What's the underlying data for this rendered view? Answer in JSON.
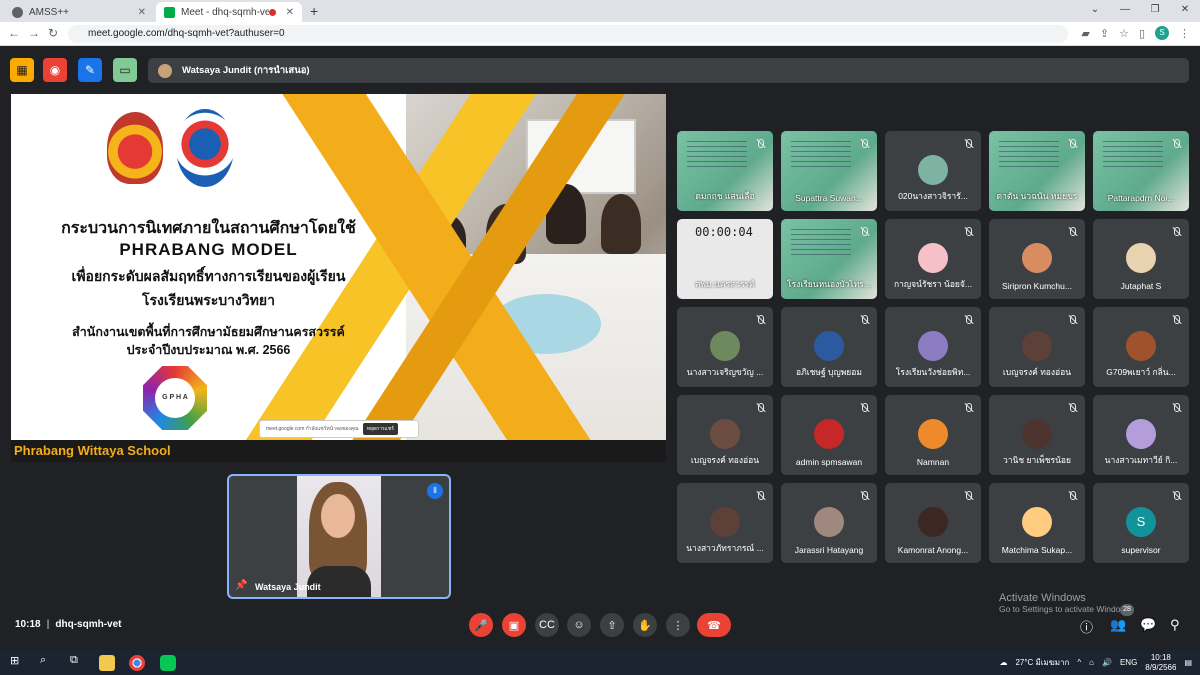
{
  "browser": {
    "tabs": [
      {
        "title": "AMSS++",
        "active": false
      },
      {
        "title": "Meet - dhq-sqmh-vet",
        "active": true
      }
    ],
    "url": "meet.google.com/dhq-sqmh-vet?authuser=0",
    "profile_initial": "S"
  },
  "meet": {
    "presenter_label": "Watsaya Jundit (การนำเสนอ)",
    "slide": {
      "line1": "กระบวนการนิเทศภายในสถานศึกษาโดยใช้",
      "line2": "PHRABANG MODEL",
      "line3": "เพื่อยกระดับผลสัมฤทธิ์ทางการเรียนของผู้เรียน",
      "line4": "โรงเรียนพระบางวิทยา",
      "line5": "สำนักงานเขตพื้นที่การศึกษามัธยมศึกษานครสวรรค์",
      "line6": "ประจำปีงบประมาณ พ.ศ. 2566",
      "logo_text": "G P H A",
      "share_text": "meet.google.com กำลังแชร์หน้าจอของคุณ",
      "share_button": "หยุดการแชร์",
      "school_name": "Phrabang Wittaya School"
    },
    "self_tile": {
      "name": "Watsaya Jundit"
    },
    "participants": [
      {
        "name": "ดมกฤช แสนเลื่อ",
        "kind": "video"
      },
      {
        "name": "Supattra Suwan...",
        "kind": "video"
      },
      {
        "name": "020นางสาวจิรารั...",
        "kind": "avatar",
        "color": "#7fb3a1"
      },
      {
        "name": "ดาตัน นวฉนัน หมยขร",
        "kind": "video"
      },
      {
        "name": "Pattarapdrn Noi...",
        "kind": "video"
      },
      {
        "name": "สพม.นครสวรรค์",
        "kind": "clock",
        "clock": "00:00:04"
      },
      {
        "name": "โรงเรียนหนองบัวไทร...",
        "kind": "video"
      },
      {
        "name": "กาญจน์รัชรา น้อยจั...",
        "kind": "avatar",
        "color": "#f6c0c8"
      },
      {
        "name": "Siripron Kumchu...",
        "kind": "avatar",
        "color": "#d98c5f"
      },
      {
        "name": "Jutaphat S",
        "kind": "avatar",
        "color": "#e8d2b0"
      },
      {
        "name": "นางสาวเจริญขวัญ ...",
        "kind": "avatar",
        "color": "#6d8a5e"
      },
      {
        "name": "อภิเชษฐ์ บุญพยอม",
        "kind": "avatar",
        "color": "#2c5aa0"
      },
      {
        "name": "โรงเรียนวังช่อยพิท...",
        "kind": "avatar",
        "color": "#8e7cc3"
      },
      {
        "name": "เบญจรงค์ ทองอ่อน",
        "kind": "avatar",
        "color": "#5d4037"
      },
      {
        "name": "G709พเยาว์ กลิ่น...",
        "kind": "avatar",
        "color": "#a0522d"
      },
      {
        "name": "เบญจรงค์ ทองอ่อน",
        "kind": "avatar",
        "color": "#6d4c41"
      },
      {
        "name": "admin spmsawan",
        "kind": "avatar",
        "color": "#c62828"
      },
      {
        "name": "Namnan",
        "kind": "avatar",
        "color": "#ef8a2b"
      },
      {
        "name": "วานิช ยาเพ็ชรน้อย",
        "kind": "avatar",
        "color": "#4e342e"
      },
      {
        "name": "นางสาวเมทาวีย์ กิ...",
        "kind": "avatar",
        "color": "#b39ddb"
      },
      {
        "name": "นางสาวภัทราภรณ์ ...",
        "kind": "avatar",
        "color": "#5d4037"
      },
      {
        "name": "Jarassri Hatayang",
        "kind": "avatar",
        "color": "#a1887f"
      },
      {
        "name": "Kamonrat Anong...",
        "kind": "avatar",
        "color": "#3e2723"
      },
      {
        "name": "Matchima Sukap...",
        "kind": "avatar",
        "color": "#ffcc80"
      },
      {
        "name": "supervisor",
        "kind": "letter",
        "letter": "S",
        "color": "#12939a"
      }
    ],
    "bottom": {
      "time": "10:18",
      "meeting_code": "dhq-sqmh-vet",
      "people_count": "28"
    }
  },
  "watermark": {
    "line1": "Activate Windows",
    "line2": "Go to Settings to activate Windows."
  },
  "taskbar": {
    "weather": "27°C มีเมฆมาก",
    "lang": "ENG",
    "time": "10:18",
    "date": "8/9/2566"
  }
}
